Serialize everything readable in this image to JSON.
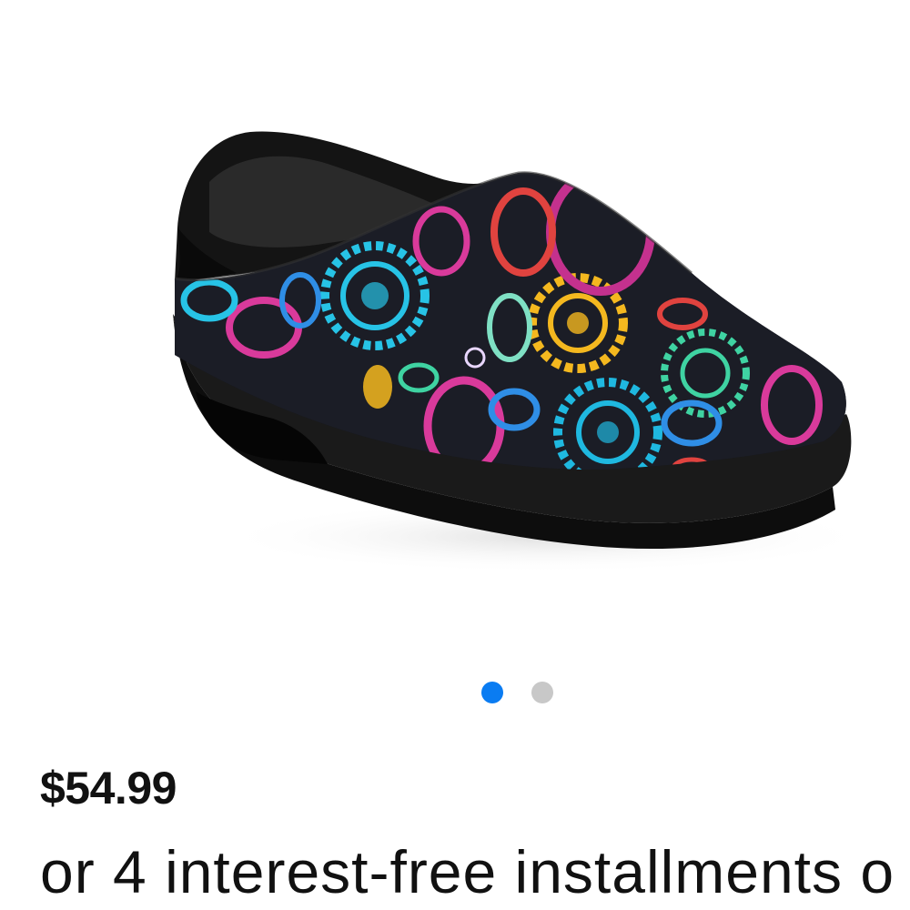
{
  "product": {
    "image_alt": "Patterned paisley slip-on clog with black sole",
    "price": "$54.99",
    "installments_text": "or 4 interest-free installments o"
  },
  "carousel": {
    "dots": [
      {
        "label": "Image 1",
        "active": true
      },
      {
        "label": "Image 2",
        "active": false
      }
    ],
    "active_color": "#0a7cf2",
    "inactive_color": "#c8c8c8"
  },
  "colors": {
    "background": "#ffffff",
    "text": "#111111"
  }
}
